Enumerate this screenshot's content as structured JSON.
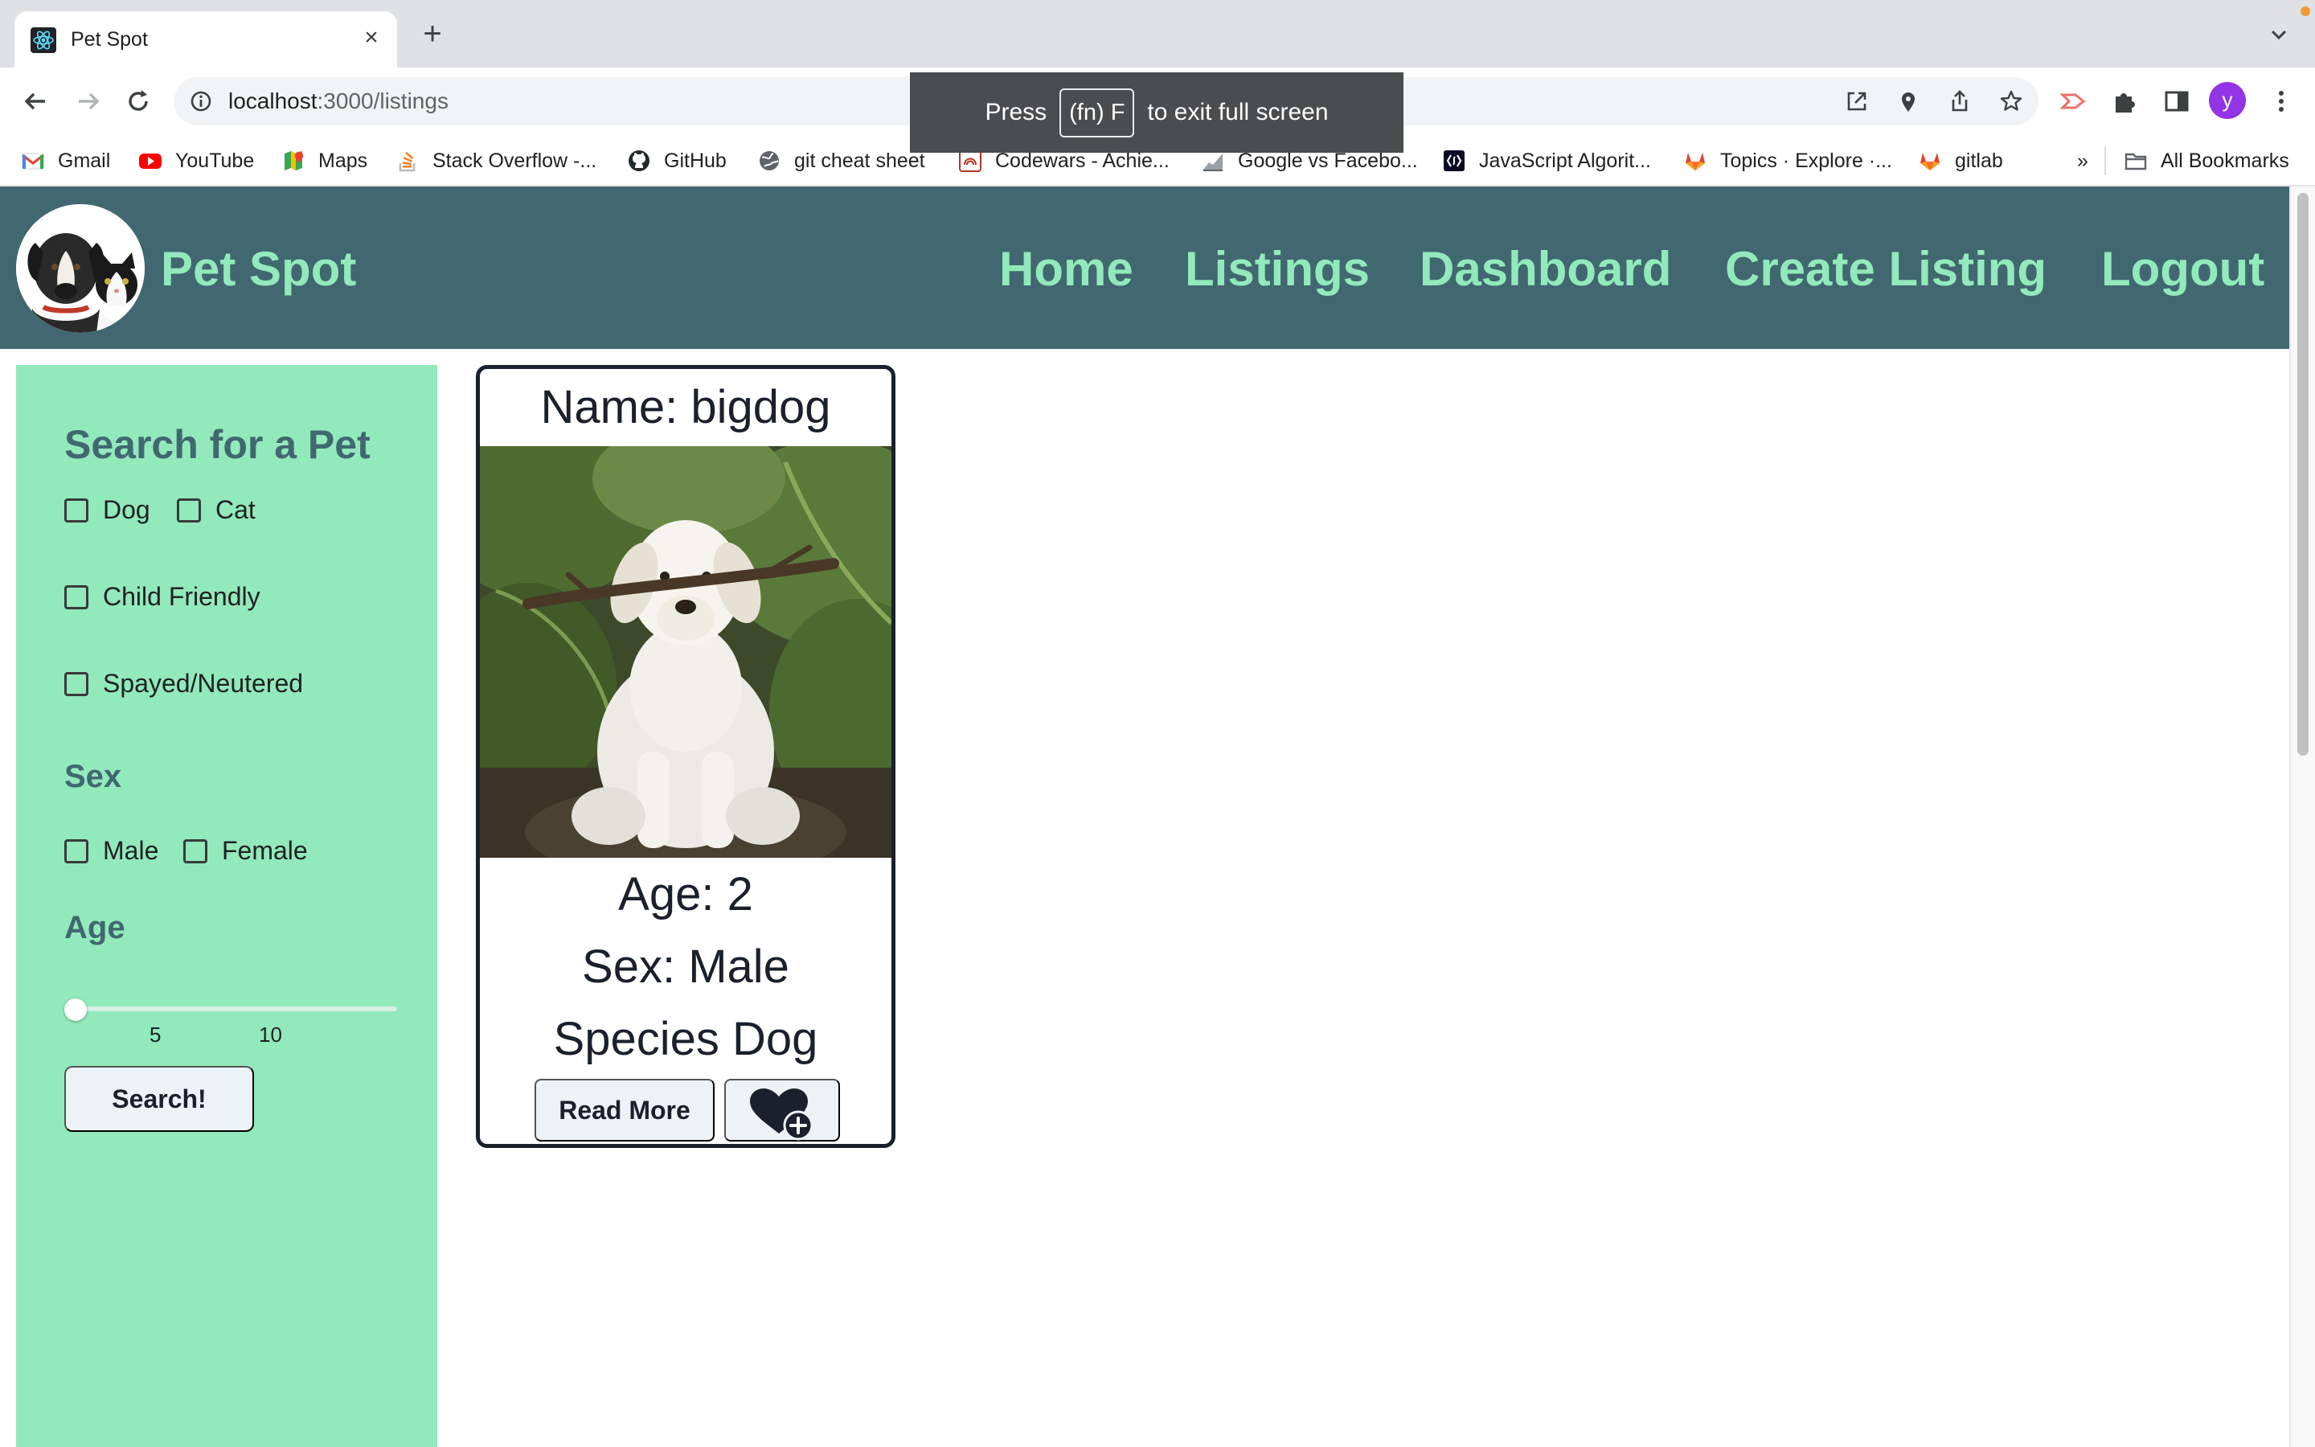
{
  "browser": {
    "tab_title": "Pet Spot",
    "new_tab": "+",
    "close_tab": "×",
    "url_host": "localhost",
    "url_path": ":3000/listings",
    "profile_initial": "y",
    "fullscreen_toast": {
      "press": "Press",
      "key": "(fn) F",
      "rest": "to exit full screen"
    },
    "bookmarks": [
      {
        "label": "Gmail",
        "icon": "gmail-icon"
      },
      {
        "label": "YouTube",
        "icon": "youtube-icon"
      },
      {
        "label": "Maps",
        "icon": "maps-icon"
      },
      {
        "label": "Stack Overflow -...",
        "icon": "stackoverflow-icon"
      },
      {
        "label": "GitHub",
        "icon": "github-icon"
      },
      {
        "label": "git cheat sheet",
        "icon": "globe-icon"
      },
      {
        "label": "Codewars - Achie...",
        "icon": "codewars-icon"
      },
      {
        "label": "Google vs Facebo...",
        "icon": "chart-icon"
      },
      {
        "label": "JavaScript Algorit...",
        "icon": "javascript-icon"
      },
      {
        "label": "Topics · Explore ·...",
        "icon": "gitlab-icon"
      },
      {
        "label": "gitlab",
        "icon": "gitlab-icon"
      }
    ],
    "bookmarks_overflow": "»",
    "all_bookmarks": "All Bookmarks"
  },
  "site": {
    "brand": "Pet Spot",
    "nav": [
      "Home",
      "Listings",
      "Dashboard",
      "Create Listing",
      "Logout"
    ],
    "colors": {
      "header": "#416870",
      "accent": "#92e9bb"
    }
  },
  "sidebar": {
    "title": "Search for a Pet",
    "species": [
      "Dog",
      "Cat"
    ],
    "child_friendly": "Child Friendly",
    "spayed": "Spayed/Neutered",
    "sex_label": "Sex",
    "sex_options": [
      "Male",
      "Female"
    ],
    "age_label": "Age",
    "age_slider": {
      "value": 0,
      "ticks": [
        "5",
        "10"
      ]
    },
    "search_button": "Search!"
  },
  "listing": {
    "name": "Name: bigdog",
    "age": "Age: 2",
    "sex": "Sex: Male",
    "species": "Species Dog",
    "read_more": "Read More",
    "favorite_icon": "heart-plus-icon"
  }
}
